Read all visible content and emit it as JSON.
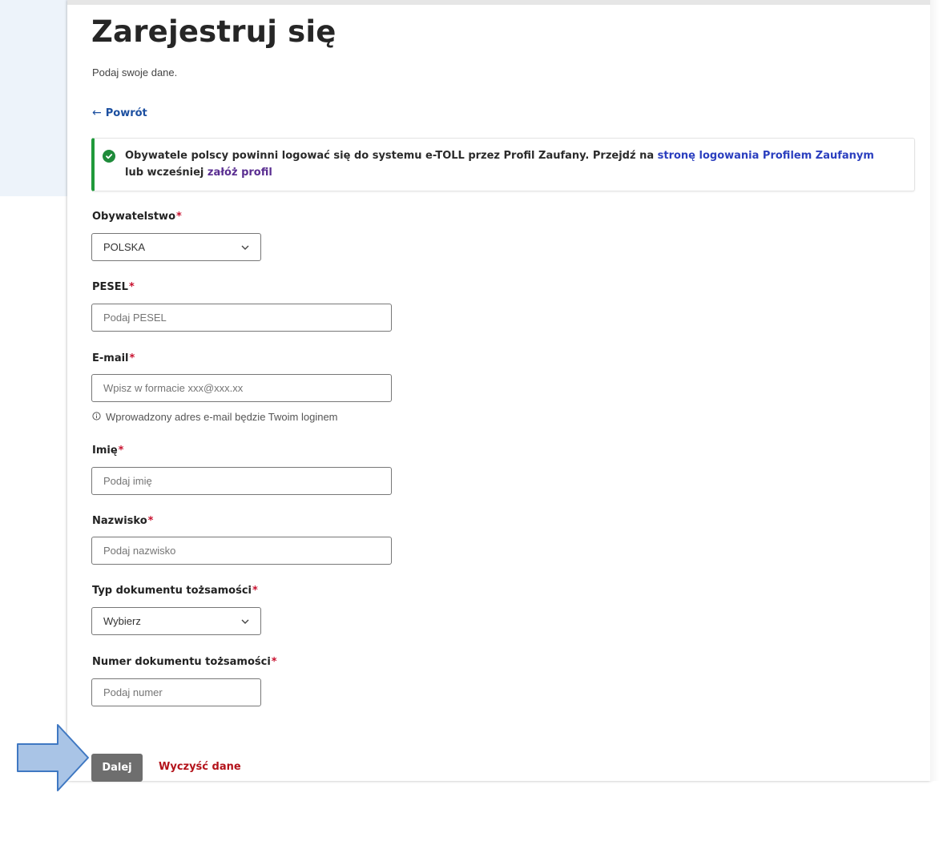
{
  "page": {
    "title": "Zarejestruj się",
    "subtitle": "Podaj swoje dane.",
    "back_link": "Powrót"
  },
  "alert": {
    "text_1": "Obywatele polscy powinni logować się do systemu e-TOLL przez Profil Zaufany. Przejdź na ",
    "link_1": "stronę logowania Profilem Zaufanym",
    "text_2": " lub wcześniej ",
    "link_2": "załóż profil"
  },
  "form": {
    "required_mark": "*",
    "citizenship": {
      "label": "Obywatelstwo",
      "value": "POLSKA"
    },
    "pesel": {
      "label": "PESEL",
      "placeholder": "Podaj PESEL"
    },
    "email": {
      "label": "E-mail",
      "placeholder": "Wpisz w formacie xxx@xxx.xx",
      "hint": "Wprowadzony adres e-mail będzie Twoim loginem"
    },
    "first_name": {
      "label": "Imię",
      "placeholder": "Podaj imię"
    },
    "last_name": {
      "label": "Nazwisko",
      "placeholder": "Podaj nazwisko"
    },
    "doc_type": {
      "label": "Typ dokumentu tożsamości",
      "value": "Wybierz"
    },
    "doc_number": {
      "label": "Numer dokumentu tożsamości",
      "placeholder": "Podaj numer"
    }
  },
  "actions": {
    "next": "Dalej",
    "clear": "Wyczyść dane"
  },
  "colors": {
    "success": "#1f8b3a",
    "link": "#2b3fbf",
    "required": "#c8102e",
    "danger": "#b3121a",
    "button": "#6e6e6e",
    "arrow": "#a9c4e6"
  }
}
